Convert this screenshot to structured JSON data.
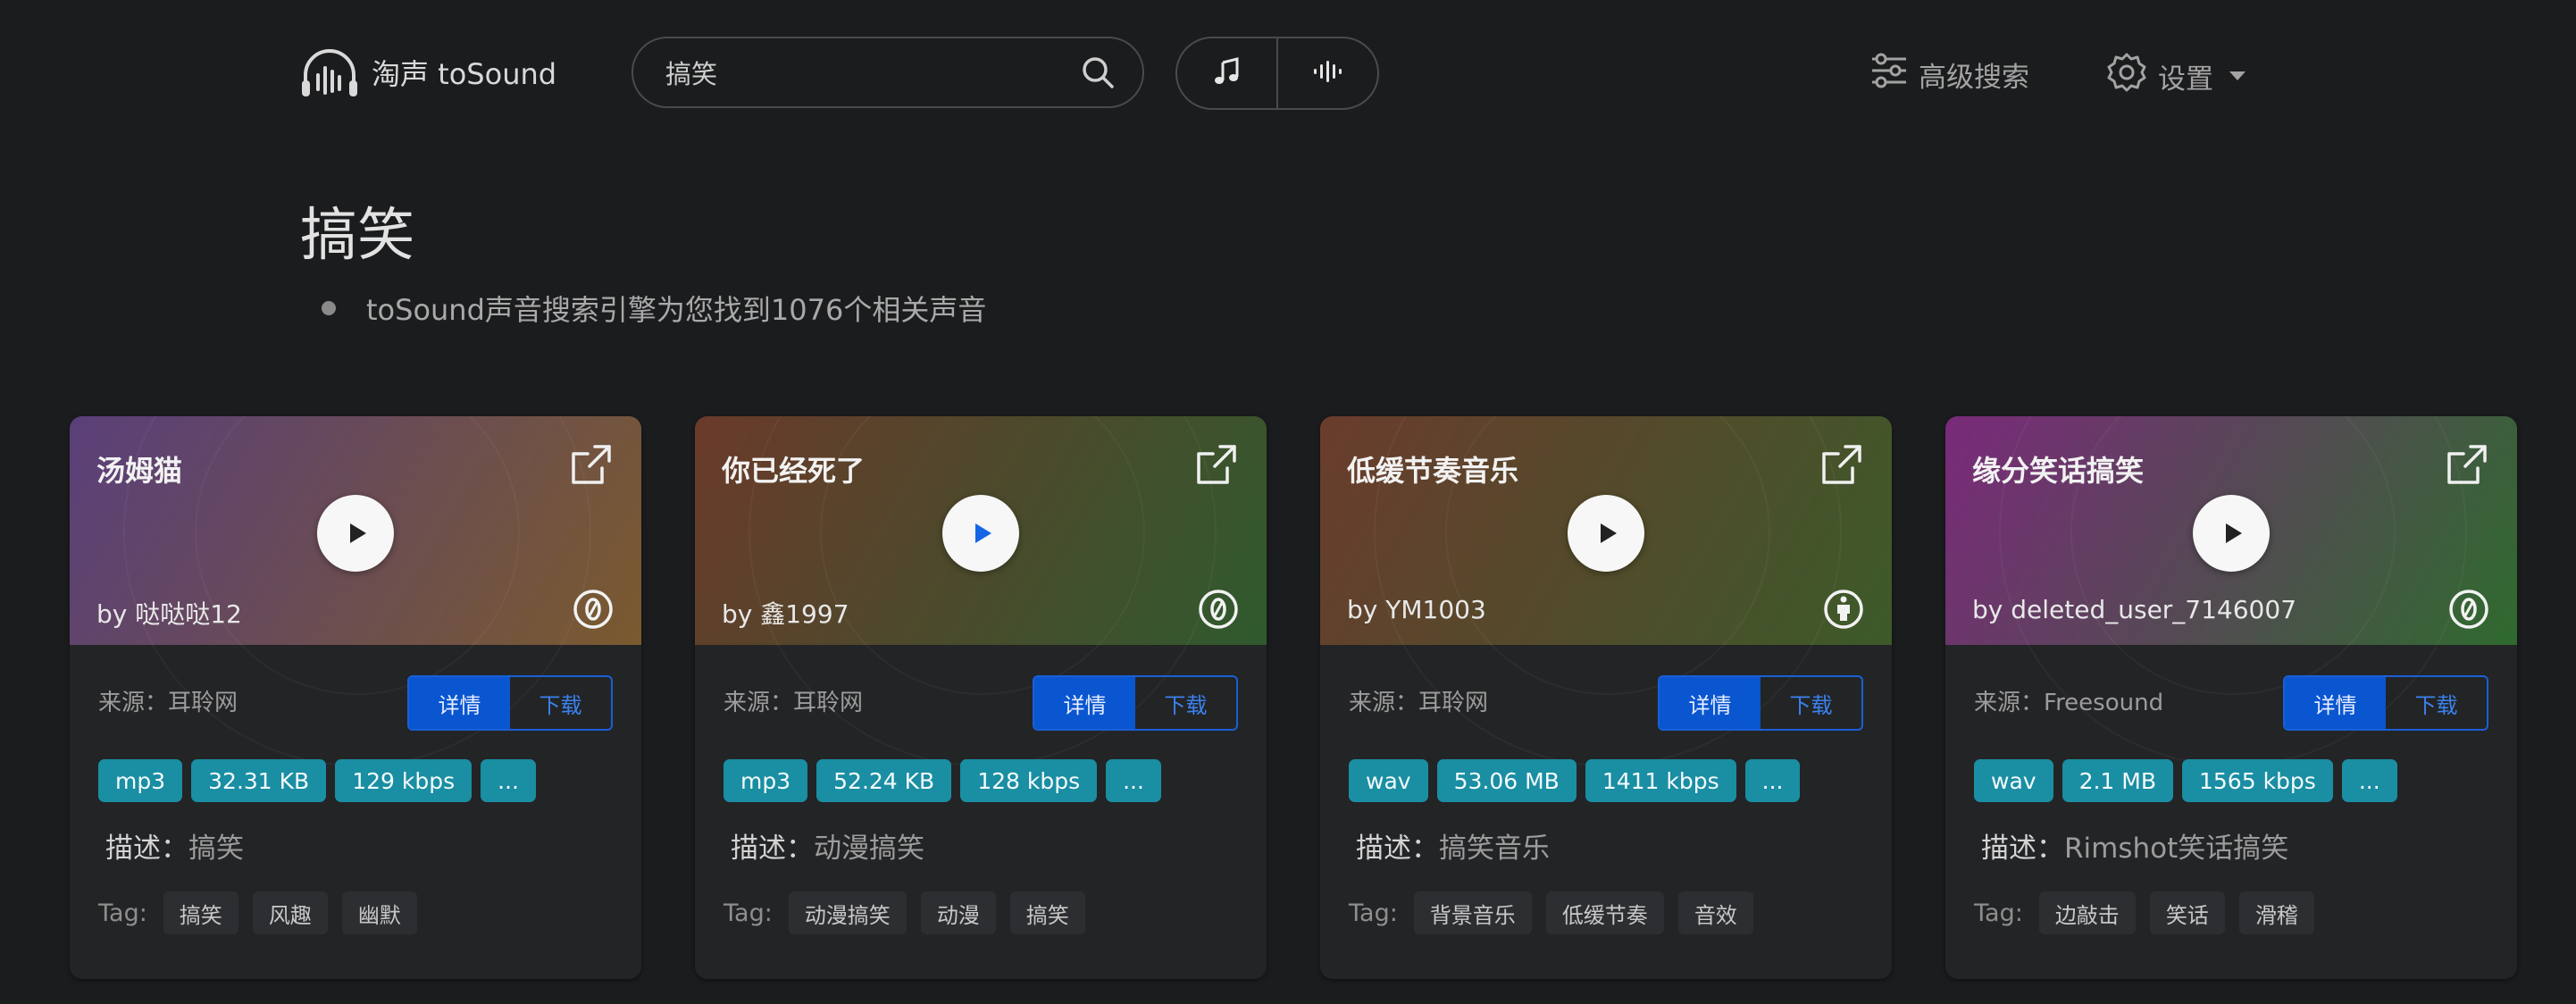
{
  "header": {
    "logo_text": "淘声 toSound",
    "search": {
      "value": "搞笑",
      "placeholder": ""
    },
    "advanced_search_label": "高级搜索",
    "settings_label": "设置"
  },
  "main": {
    "title": "搞笑",
    "result_summary": "toSound声音搜索引擎为您找到1076个相关声音"
  },
  "cards": [
    {
      "title": "汤姆猫",
      "author": "by 哒哒哒12",
      "license_icon": "cc0-icon",
      "source": "来源：耳聆网",
      "detail_label": "详情",
      "download_label": "下载",
      "badges": [
        "mp3",
        "32.31 KB",
        "129 kbps",
        "..."
      ],
      "desc_label": "描述：",
      "desc_value": "搞笑",
      "tag_label": "Tag:",
      "tags": [
        "搞笑",
        "风趣",
        "幽默"
      ],
      "gradient": [
        "#5a3f7a",
        "#7a5a2e"
      ]
    },
    {
      "title": "你已经死了",
      "author": "by 鑫1997",
      "license_icon": "cc0-icon",
      "source": "来源：耳聆网",
      "detail_label": "详情",
      "download_label": "下载",
      "badges": [
        "mp3",
        "52.24 KB",
        "128 kbps",
        "..."
      ],
      "desc_label": "描述：",
      "desc_value": "动漫搞笑",
      "tag_label": "Tag:",
      "tags": [
        "动漫搞笑",
        "动漫",
        "搞笑"
      ],
      "gradient": [
        "#6a3a2a",
        "#2f5a2e"
      ]
    },
    {
      "title": "低缓节奏音乐",
      "author": "by YM1003",
      "license_icon": "attribution-icon",
      "source": "来源：耳聆网",
      "detail_label": "详情",
      "download_label": "下载",
      "badges": [
        "wav",
        "53.06 MB",
        "1411 kbps",
        "..."
      ],
      "desc_label": "描述：",
      "desc_value": "搞笑音乐",
      "tag_label": "Tag:",
      "tags": [
        "背景音乐",
        "低缓节奏",
        "音效"
      ],
      "gradient": [
        "#6a3c2c",
        "#3c5a2a"
      ]
    },
    {
      "title": "缘分笑话搞笑",
      "author": "by deleted_user_7146007",
      "license_icon": "cc0-icon",
      "source": "来源：Freesound",
      "detail_label": "详情",
      "download_label": "下载",
      "badges": [
        "wav",
        "2.1 MB",
        "1565 kbps",
        "..."
      ],
      "desc_label": "描述：",
      "desc_value": "Rimshot笑话搞笑",
      "tag_label": "Tag:",
      "tags": [
        "边敲击",
        "笑话",
        "滑稽"
      ],
      "gradient": [
        "#7a2a7a",
        "#2f6a2e"
      ]
    }
  ]
}
